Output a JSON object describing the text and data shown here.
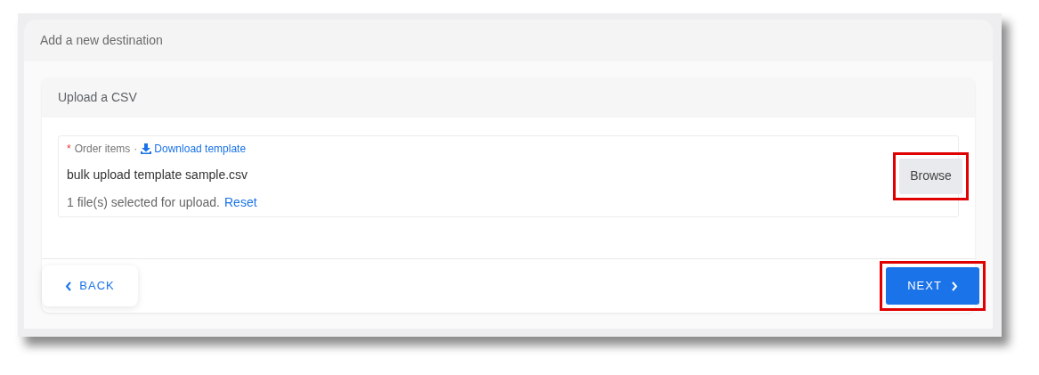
{
  "dialog": {
    "title": "Add a new destination"
  },
  "panel": {
    "title": "Upload a CSV"
  },
  "field": {
    "required_mark": "*",
    "label": "Order items",
    "separator": "·",
    "download_link": "Download template",
    "file_name": "bulk upload template sample.csv",
    "status": "1 file(s) selected for upload.",
    "reset_link": "Reset"
  },
  "browse_button": {
    "label": "Browse",
    "highlighted": true
  },
  "back_button": {
    "label": "BACK",
    "highlighted": false
  },
  "next_button": {
    "label": "NEXT",
    "highlighted": true
  }
}
